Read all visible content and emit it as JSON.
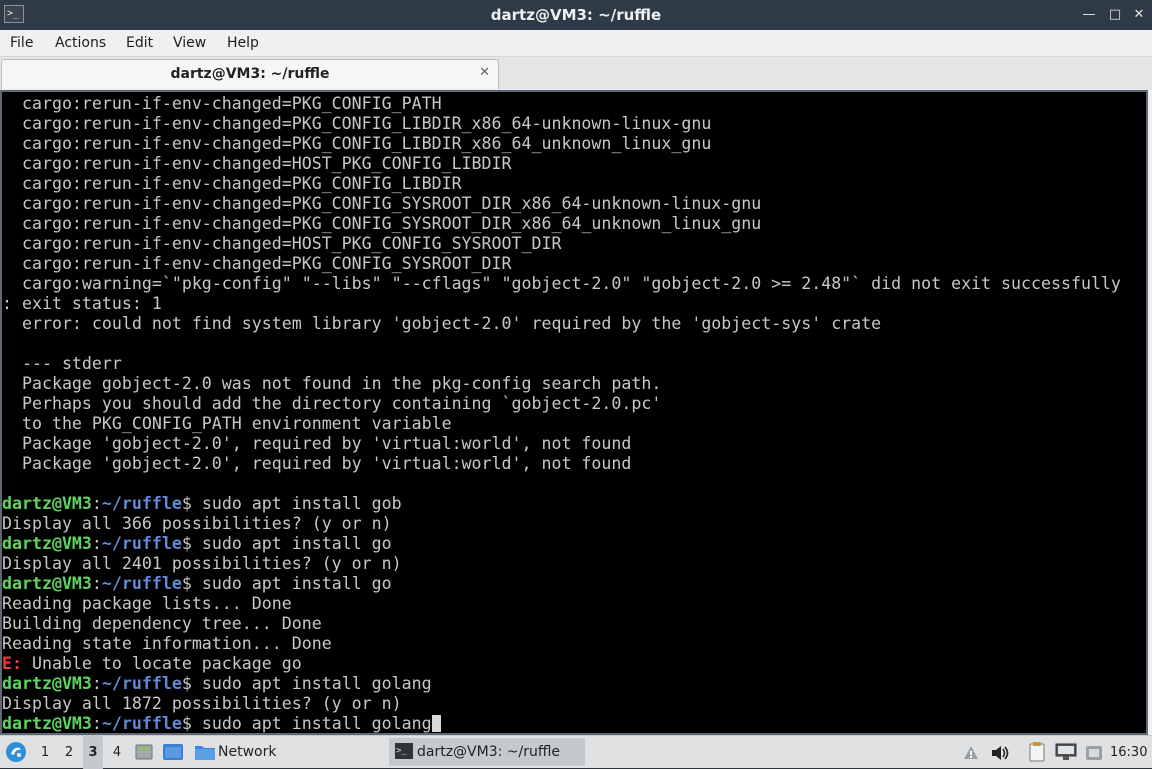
{
  "window": {
    "title": "dartz@VM3: ~/ruffle",
    "icon": "terminal-icon",
    "minimize_glyph": "—",
    "maximize_glyph": "□",
    "close_glyph": "✕"
  },
  "menu": {
    "file": "File",
    "actions": "Actions",
    "edit": "Edit",
    "view": "View",
    "help": "Help"
  },
  "tab": {
    "label": "dartz@VM3: ~/ruffle",
    "close_glyph": "✕"
  },
  "terminal": {
    "prompt_user": "dartz@VM3",
    "prompt_sep": ":",
    "prompt_path": "~/ruffle",
    "prompt_dollar": "$ ",
    "lines": [
      "  cargo:rerun-if-env-changed=PKG_CONFIG_PATH",
      "  cargo:rerun-if-env-changed=PKG_CONFIG_LIBDIR_x86_64-unknown-linux-gnu",
      "  cargo:rerun-if-env-changed=PKG_CONFIG_LIBDIR_x86_64_unknown_linux_gnu",
      "  cargo:rerun-if-env-changed=HOST_PKG_CONFIG_LIBDIR",
      "  cargo:rerun-if-env-changed=PKG_CONFIG_LIBDIR",
      "  cargo:rerun-if-env-changed=PKG_CONFIG_SYSROOT_DIR_x86_64-unknown-linux-gnu",
      "  cargo:rerun-if-env-changed=PKG_CONFIG_SYSROOT_DIR_x86_64_unknown_linux_gnu",
      "  cargo:rerun-if-env-changed=HOST_PKG_CONFIG_SYSROOT_DIR",
      "  cargo:rerun-if-env-changed=PKG_CONFIG_SYSROOT_DIR",
      "  cargo:warning=`\"pkg-config\" \"--libs\" \"--cflags\" \"gobject-2.0\" \"gobject-2.0 >= 2.48\"` did not exit successfully",
      ": exit status: 1",
      "  error: could not find system library 'gobject-2.0' required by the 'gobject-sys' crate",
      "",
      "  --- stderr",
      "  Package gobject-2.0 was not found in the pkg-config search path.",
      "  Perhaps you should add the directory containing `gobject-2.0.pc'",
      "  to the PKG_CONFIG_PATH environment variable",
      "  Package 'gobject-2.0', required by 'virtual:world', not found",
      "  Package 'gobject-2.0', required by 'virtual:world', not found",
      ""
    ],
    "cmd1": "sudo apt install gob",
    "out1": "Display all 366 possibilities? (y or n)",
    "cmd2": "sudo apt install go",
    "out2": "Display all 2401 possibilities? (y or n)",
    "cmd3": "sudo apt install go",
    "out3a": "Reading package lists... Done",
    "out3b": "Building dependency tree... Done",
    "out3c": "Reading state information... Done",
    "err_prefix": "E:",
    "err_text": " Unable to locate package go",
    "cmd4": "sudo apt install golang",
    "out4": "Display all 1872 possibilities? (y or n)",
    "cmd5": "sudo apt install golang"
  },
  "taskbar": {
    "start_icon": "start-menu-icon",
    "workspaces": [
      "1",
      "2",
      "3",
      "4"
    ],
    "active_workspace": "3",
    "file_manager_task": "Network",
    "terminal_task": "dartz@VM3: ~/ruffle",
    "tray_icons": [
      "notification-icon",
      "volume-icon",
      "clipboard-icon",
      "network-icon",
      "power-icon"
    ],
    "clock": "16:30"
  },
  "colors": {
    "prompt_user": "#5ed55e",
    "prompt_path": "#5e8ad8",
    "error": "#ee3b3b",
    "terminal_bg": "#000000",
    "titlebar_bg": "#2e3a46"
  }
}
